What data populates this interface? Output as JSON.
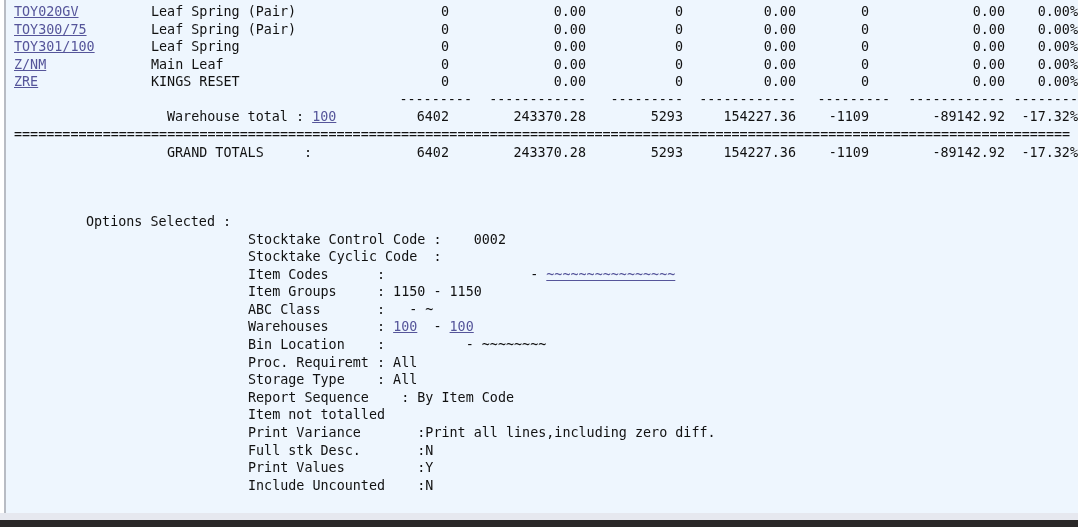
{
  "item_rows": [
    {
      "code": "TOY020GV",
      "description": "Leaf Spring (Pair)",
      "values": [
        "0",
        "0.00",
        "0",
        "0.00",
        "0",
        "0.00",
        "0.00%"
      ]
    },
    {
      "code": "TOY300/75",
      "description": "Leaf Spring (Pair)",
      "values": [
        "0",
        "0.00",
        "0",
        "0.00",
        "0",
        "0.00",
        "0.00%"
      ]
    },
    {
      "code": "TOY301/100",
      "description": "Leaf Spring",
      "values": [
        "0",
        "0.00",
        "0",
        "0.00",
        "0",
        "0.00",
        "0.00%"
      ]
    },
    {
      "code": "Z/NM",
      "description": "Main Leaf",
      "values": [
        "0",
        "0.00",
        "0",
        "0.00",
        "0",
        "0.00",
        "0.00%"
      ]
    },
    {
      "code": "ZRE",
      "description": "KINGS RESET",
      "values": [
        "0",
        "0.00",
        "0",
        "0.00",
        "0",
        "0.00",
        "0.00%"
      ]
    }
  ],
  "separator_dashes": [
    "---------",
    "------------",
    "---------",
    "------------",
    "---------",
    "------------",
    "--------"
  ],
  "warehouse_total": {
    "label": "Warehouse total : ",
    "warehouse": "100",
    "values": [
      "6402",
      "243370.28",
      "5293",
      "154227.36",
      "-1109",
      "-89142.92",
      "-17.32%"
    ]
  },
  "double_rule": "===================================================================================================================================",
  "grand_totals": {
    "label": "GRAND TOTALS     :",
    "values": [
      "6402",
      "243370.28",
      "5293",
      "154227.36",
      "-1109",
      "-89142.92",
      "-17.32%"
    ]
  },
  "options": {
    "title": "Options Selected :",
    "lines": [
      {
        "parts": [
          {
            "text": "Stocktake Control Code :    0002",
            "link": false
          }
        ]
      },
      {
        "parts": [
          {
            "text": "Stocktake Cyclic Code  :",
            "link": false
          }
        ]
      },
      {
        "parts": [
          {
            "text": "Item Codes      :                  - ",
            "link": false
          },
          {
            "text": "~~~~~~~~~~~~~~~~",
            "link": true
          }
        ]
      },
      {
        "parts": [
          {
            "text": "Item Groups     : 1150 - 1150",
            "link": false
          }
        ]
      },
      {
        "parts": [
          {
            "text": "ABC Class       :   - ~",
            "link": false
          }
        ]
      },
      {
        "parts": [
          {
            "text": "Warehouses      : ",
            "link": false
          },
          {
            "text": "100",
            "link": true
          },
          {
            "text": "  - ",
            "link": false
          },
          {
            "text": "100",
            "link": true
          }
        ]
      },
      {
        "parts": [
          {
            "text": "Bin Location    :          - ~~~~~~~~",
            "link": false
          }
        ]
      },
      {
        "parts": [
          {
            "text": "Proc. Requiremt : All",
            "link": false
          }
        ]
      },
      {
        "parts": [
          {
            "text": "Storage Type    : All",
            "link": false
          }
        ]
      },
      {
        "parts": [
          {
            "text": "Report Sequence    : By Item Code",
            "link": false
          }
        ]
      },
      {
        "parts": [
          {
            "text": "Item not totalled",
            "link": false
          }
        ]
      },
      {
        "parts": [
          {
            "text": "Print Variance       :Print all lines,including zero diff.",
            "link": false
          }
        ]
      },
      {
        "parts": [
          {
            "text": "Full stk Desc.       :N",
            "link": false
          }
        ]
      },
      {
        "parts": [
          {
            "text": "Print Values         :Y",
            "link": false
          }
        ]
      },
      {
        "parts": [
          {
            "text": "Include Uncounted    :N",
            "link": false
          }
        ]
      }
    ]
  }
}
